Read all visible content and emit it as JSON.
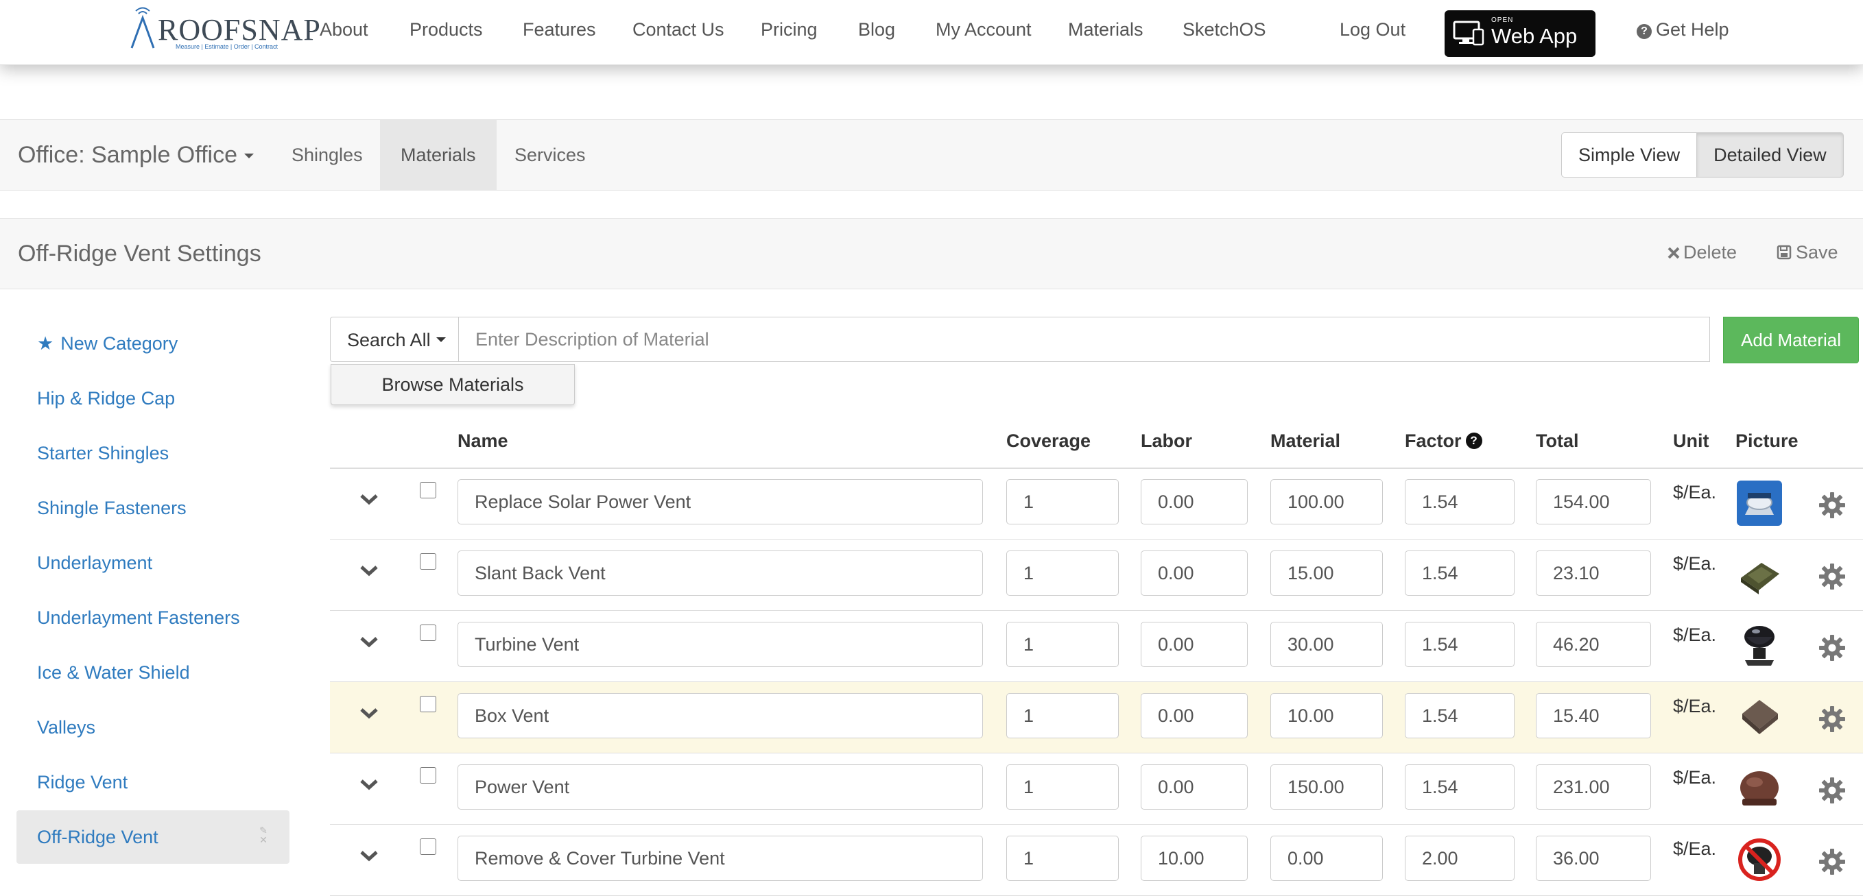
{
  "brand": {
    "name": "ROOFSNAP",
    "tagline": "Measure | Estimate | Order | Contract",
    "accent": "#2f7bbf",
    "success": "#5cb85c"
  },
  "nav": {
    "links": [
      "About",
      "Products",
      "Features",
      "Contact Us",
      "Pricing",
      "Blog",
      "My Account",
      "Materials",
      "SketchOS"
    ],
    "logout": "Log Out",
    "webapp_small": "OPEN",
    "webapp_label": "Web App",
    "help": "Get Help"
  },
  "office": {
    "label": "Office: Sample Office",
    "tabs": [
      "Shingles",
      "Materials",
      "Services"
    ],
    "active_tab": "Materials",
    "views": [
      "Simple View",
      "Detailed View"
    ],
    "active_view": "Detailed View"
  },
  "settings": {
    "title": "Off-Ridge Vent Settings",
    "delete_label": "Delete",
    "save_label": "Save"
  },
  "sidebar": {
    "items": [
      {
        "label": "New Category",
        "icon": "star-icon"
      },
      {
        "label": "Hip & Ridge Cap"
      },
      {
        "label": "Starter Shingles"
      },
      {
        "label": "Shingle Fasteners"
      },
      {
        "label": "Underlayment"
      },
      {
        "label": "Underlayment Fasteners"
      },
      {
        "label": "Ice & Water Shield"
      },
      {
        "label": "Valleys"
      },
      {
        "label": "Ridge Vent"
      },
      {
        "label": "Off-Ridge Vent",
        "active": true
      }
    ]
  },
  "search": {
    "scope": "Search All",
    "placeholder": "Enter Description of Material",
    "value": "",
    "add_label": "Add Material",
    "browse_label": "Browse Materials"
  },
  "table": {
    "headers": {
      "name": "Name",
      "coverage": "Coverage",
      "labor": "Labor",
      "material": "Material",
      "factor": "Factor",
      "total": "Total",
      "unit": "Unit",
      "picture": "Picture"
    },
    "rows": [
      {
        "name": "Replace Solar Power Vent",
        "coverage": "1",
        "labor": "0.00",
        "material": "100.00",
        "factor": "1.54",
        "total": "154.00",
        "unit": "$/Ea.",
        "picture": "solar-vent-image",
        "highlight": false
      },
      {
        "name": "Slant Back Vent",
        "coverage": "1",
        "labor": "0.00",
        "material": "15.00",
        "factor": "1.54",
        "total": "23.10",
        "unit": "$/Ea.",
        "picture": "slant-vent-image",
        "highlight": false
      },
      {
        "name": "Turbine Vent",
        "coverage": "1",
        "labor": "0.00",
        "material": "30.00",
        "factor": "1.54",
        "total": "46.20",
        "unit": "$/Ea.",
        "picture": "turbine-vent-image",
        "highlight": false
      },
      {
        "name": "Box Vent",
        "coverage": "1",
        "labor": "0.00",
        "material": "10.00",
        "factor": "1.54",
        "total": "15.40",
        "unit": "$/Ea.",
        "picture": "box-vent-image",
        "highlight": true
      },
      {
        "name": "Power Vent",
        "coverage": "1",
        "labor": "0.00",
        "material": "150.00",
        "factor": "1.54",
        "total": "231.00",
        "unit": "$/Ea.",
        "picture": "power-vent-image",
        "highlight": false
      },
      {
        "name": "Remove & Cover Turbine Vent",
        "coverage": "1",
        "labor": "10.00",
        "material": "0.00",
        "factor": "2.00",
        "total": "36.00",
        "unit": "$/Ea.",
        "picture": "remove-vent-image",
        "highlight": false
      }
    ]
  }
}
